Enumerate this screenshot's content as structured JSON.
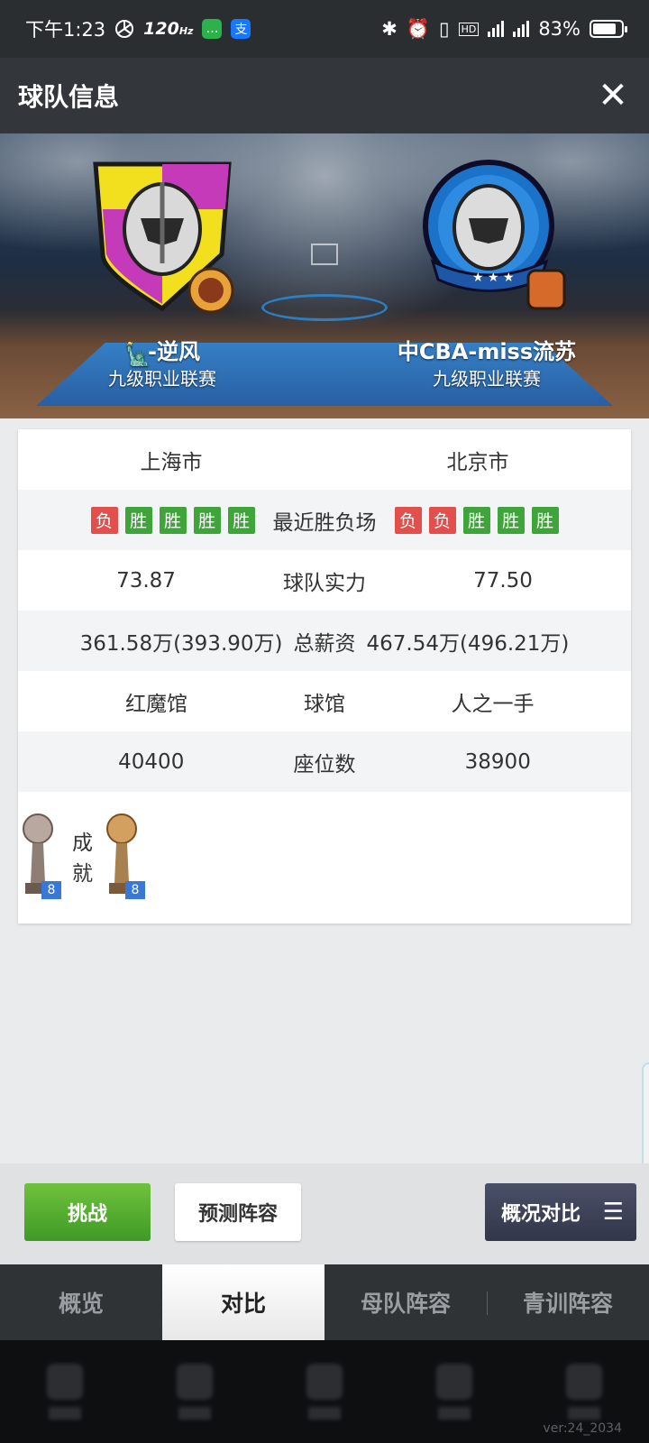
{
  "status_bar": {
    "time": "下午1:23",
    "refresh_rate": "120",
    "refresh_unit": "Hz",
    "battery": "83%",
    "battery_level": 0.83
  },
  "header": {
    "title": "球队信息",
    "close_glyph": "✕"
  },
  "teams": {
    "home": {
      "name": "-逆风",
      "league": "九级职业联赛",
      "city": "上海市",
      "recent": [
        "负",
        "胜",
        "胜",
        "胜",
        "胜"
      ],
      "strength": "73.87",
      "salary": "361.58万(393.90万)",
      "arena": "红魔馆",
      "seats": "40400",
      "trophies": "8"
    },
    "away": {
      "name": "中CBA-miss流苏",
      "league": "九级职业联赛",
      "city": "北京市",
      "recent": [
        "负",
        "负",
        "胜",
        "胜",
        "胜"
      ],
      "strength": "77.50",
      "salary": "467.54万(496.21万)",
      "arena": "人之一手",
      "seats": "38900",
      "trophies": "8"
    }
  },
  "labels": {
    "recent": "最近胜负场",
    "strength": "球队实力",
    "salary": "总薪资",
    "arena": "球馆",
    "seats": "座位数",
    "achievements": "成就"
  },
  "actions": {
    "challenge": "挑战",
    "predict": "预测阵容",
    "overview_compare": "概况对比",
    "menu_glyph": "☰"
  },
  "tabs": [
    {
      "label": "概览",
      "active": false
    },
    {
      "label": "对比",
      "active": true
    },
    {
      "label": "母队阵容",
      "active": false
    },
    {
      "label": "青训阵容",
      "active": false
    }
  ],
  "version": "ver:24_2034",
  "colors": {
    "win": "#3fa43a",
    "loss": "#e2504d",
    "challenge": "#4fa82c",
    "header": "#33373b"
  }
}
